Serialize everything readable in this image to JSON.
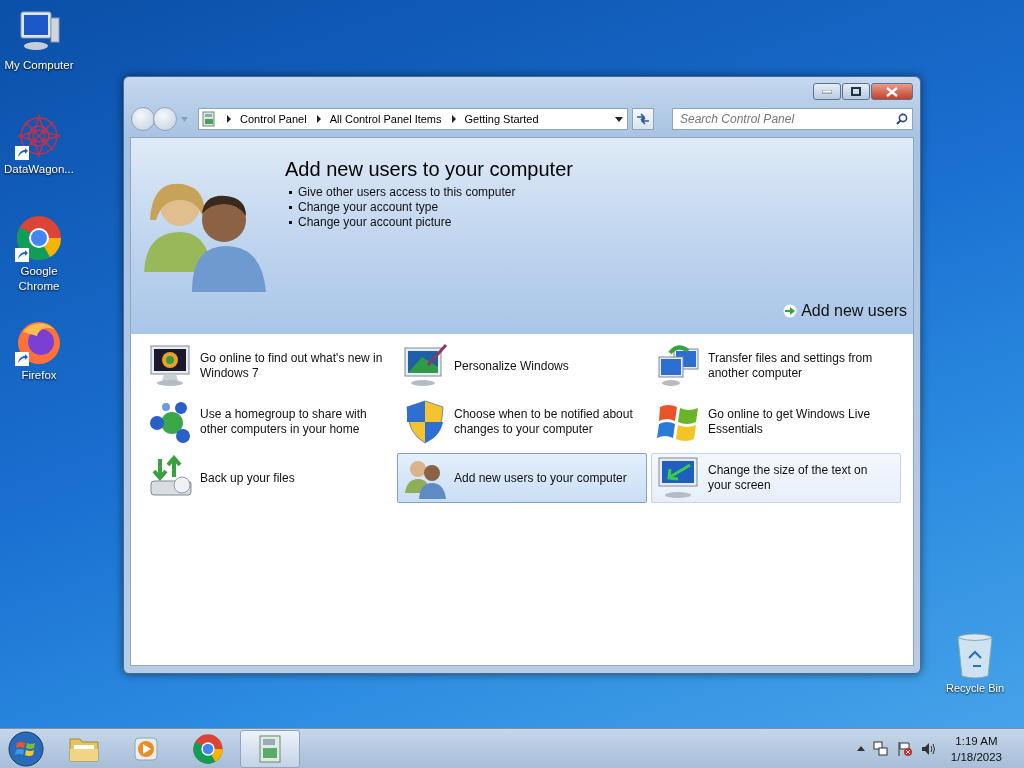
{
  "desktop_icons": [
    {
      "label": "My Computer",
      "shortcut": false
    },
    {
      "label": "DataWagon...",
      "shortcut": true
    },
    {
      "label": "Google Chrome",
      "shortcut": true
    },
    {
      "label": "Firefox",
      "shortcut": true
    }
  ],
  "recycle_bin": {
    "label": "Recycle Bin"
  },
  "window": {
    "breadcrumb": [
      "Control Panel",
      "All Control Panel Items",
      "Getting Started"
    ],
    "search": {
      "placeholder": "Search Control Panel"
    },
    "banner": {
      "title": "Add new users to your computer",
      "bullets": [
        "Give other users access to this computer",
        "Change your account type",
        "Change your account picture"
      ],
      "action": "Add new users"
    },
    "tasks": [
      {
        "label": "Go online to find out what's new in Windows 7",
        "selected": false,
        "hovered": false
      },
      {
        "label": "Personalize Windows",
        "selected": false,
        "hovered": false
      },
      {
        "label": "Transfer files and settings from another computer",
        "selected": false,
        "hovered": false
      },
      {
        "label": "Use a homegroup to share with other computers in your home",
        "selected": false,
        "hovered": false
      },
      {
        "label": "Choose when to be notified about changes to your computer",
        "selected": false,
        "hovered": false
      },
      {
        "label": "Go online to get Windows Live Essentials",
        "selected": false,
        "hovered": false
      },
      {
        "label": "Back up your files",
        "selected": false,
        "hovered": false
      },
      {
        "label": "Add new users to your computer",
        "selected": true,
        "hovered": false
      },
      {
        "label": "Change the size of the text on your screen",
        "selected": false,
        "hovered": true
      }
    ]
  },
  "taskbar": {
    "items": [
      {
        "selected": false
      },
      {
        "selected": false
      },
      {
        "selected": false
      },
      {
        "selected": true
      }
    ],
    "clock": {
      "time": "1:19 AM",
      "date": "1/18/2023"
    }
  }
}
